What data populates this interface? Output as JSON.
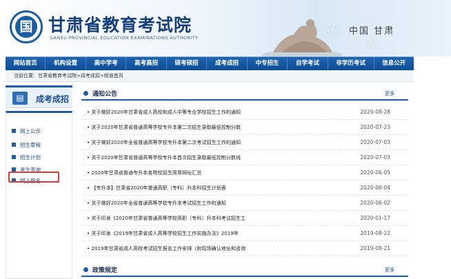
{
  "header": {
    "logo_glyph": "国",
    "title": "甘肃省教育考试院",
    "subtitle": "GANSU PROVINCIAL EDUCATION EXAMINATIONS AUTHORITY",
    "right_text": "中国 甘肃"
  },
  "nav": {
    "items": [
      "网站首页",
      "机构设置",
      "高中学考",
      "高考高招",
      "硕考硕招",
      "成考成招",
      "中专招生",
      "自学考试",
      "非学历考试",
      "信息公开"
    ]
  },
  "breadcrumb": "当前位置：甘肃省教育考试院>成考成招>频道首页",
  "sidebar": {
    "title": "成考成招",
    "items": [
      "网上公示",
      "招生章程",
      "招生计划",
      "考生查询",
      "网上报名"
    ]
  },
  "notices": {
    "title": "通知公告",
    "more": "更多",
    "items": [
      {
        "title": "关于做好2020年甘肃省成人高校和成人中等专业学校招生工作的通知",
        "date": "2020-08-28"
      },
      {
        "title": "关于2020年甘肃省普通高等学校专升本第二次招生录取最低控制分数",
        "date": "2020-07-23"
      },
      {
        "title": "关于做好2020年全省普通高等学校专升本第二次考试招生工作的通知",
        "date": "2020-07-03"
      },
      {
        "title": "关于2020年甘肃省普通高等学校专升本首次招生录取最低控制分数线",
        "date": "2020-07-03"
      },
      {
        "title": "2020年甘肃省普通专升本各院校招生简章网址汇总",
        "date": "2020-06-05"
      },
      {
        "title": "【专升本】甘肃省2020年普通高职（专科）升本科招生计划表",
        "date": "2020-06-04"
      },
      {
        "title": "关于做好2020年全省普通高等学校专升本考试招生工作的通知",
        "date": "2020-06-02"
      },
      {
        "title": "关于印发《2020年甘肃省普通高等学校高职（专科）升本科考试招生工",
        "date": "2020-01-17"
      },
      {
        "title": "关于印发《2019年甘肃省成人高等学校招生工作实施办法》2019年",
        "date": "2019-08-22"
      },
      {
        "title": "2019年甘肃省成人高校考试招生报名工作安排（附现场确认地址和咨询",
        "date": "2019-08-21"
      }
    ]
  },
  "policy": {
    "title": "政策规定",
    "more": "更多"
  },
  "colors": {
    "nav_blue": "#0f4d96",
    "accent_blue": "#1c5da6",
    "highlight_red": "#e03a36"
  }
}
